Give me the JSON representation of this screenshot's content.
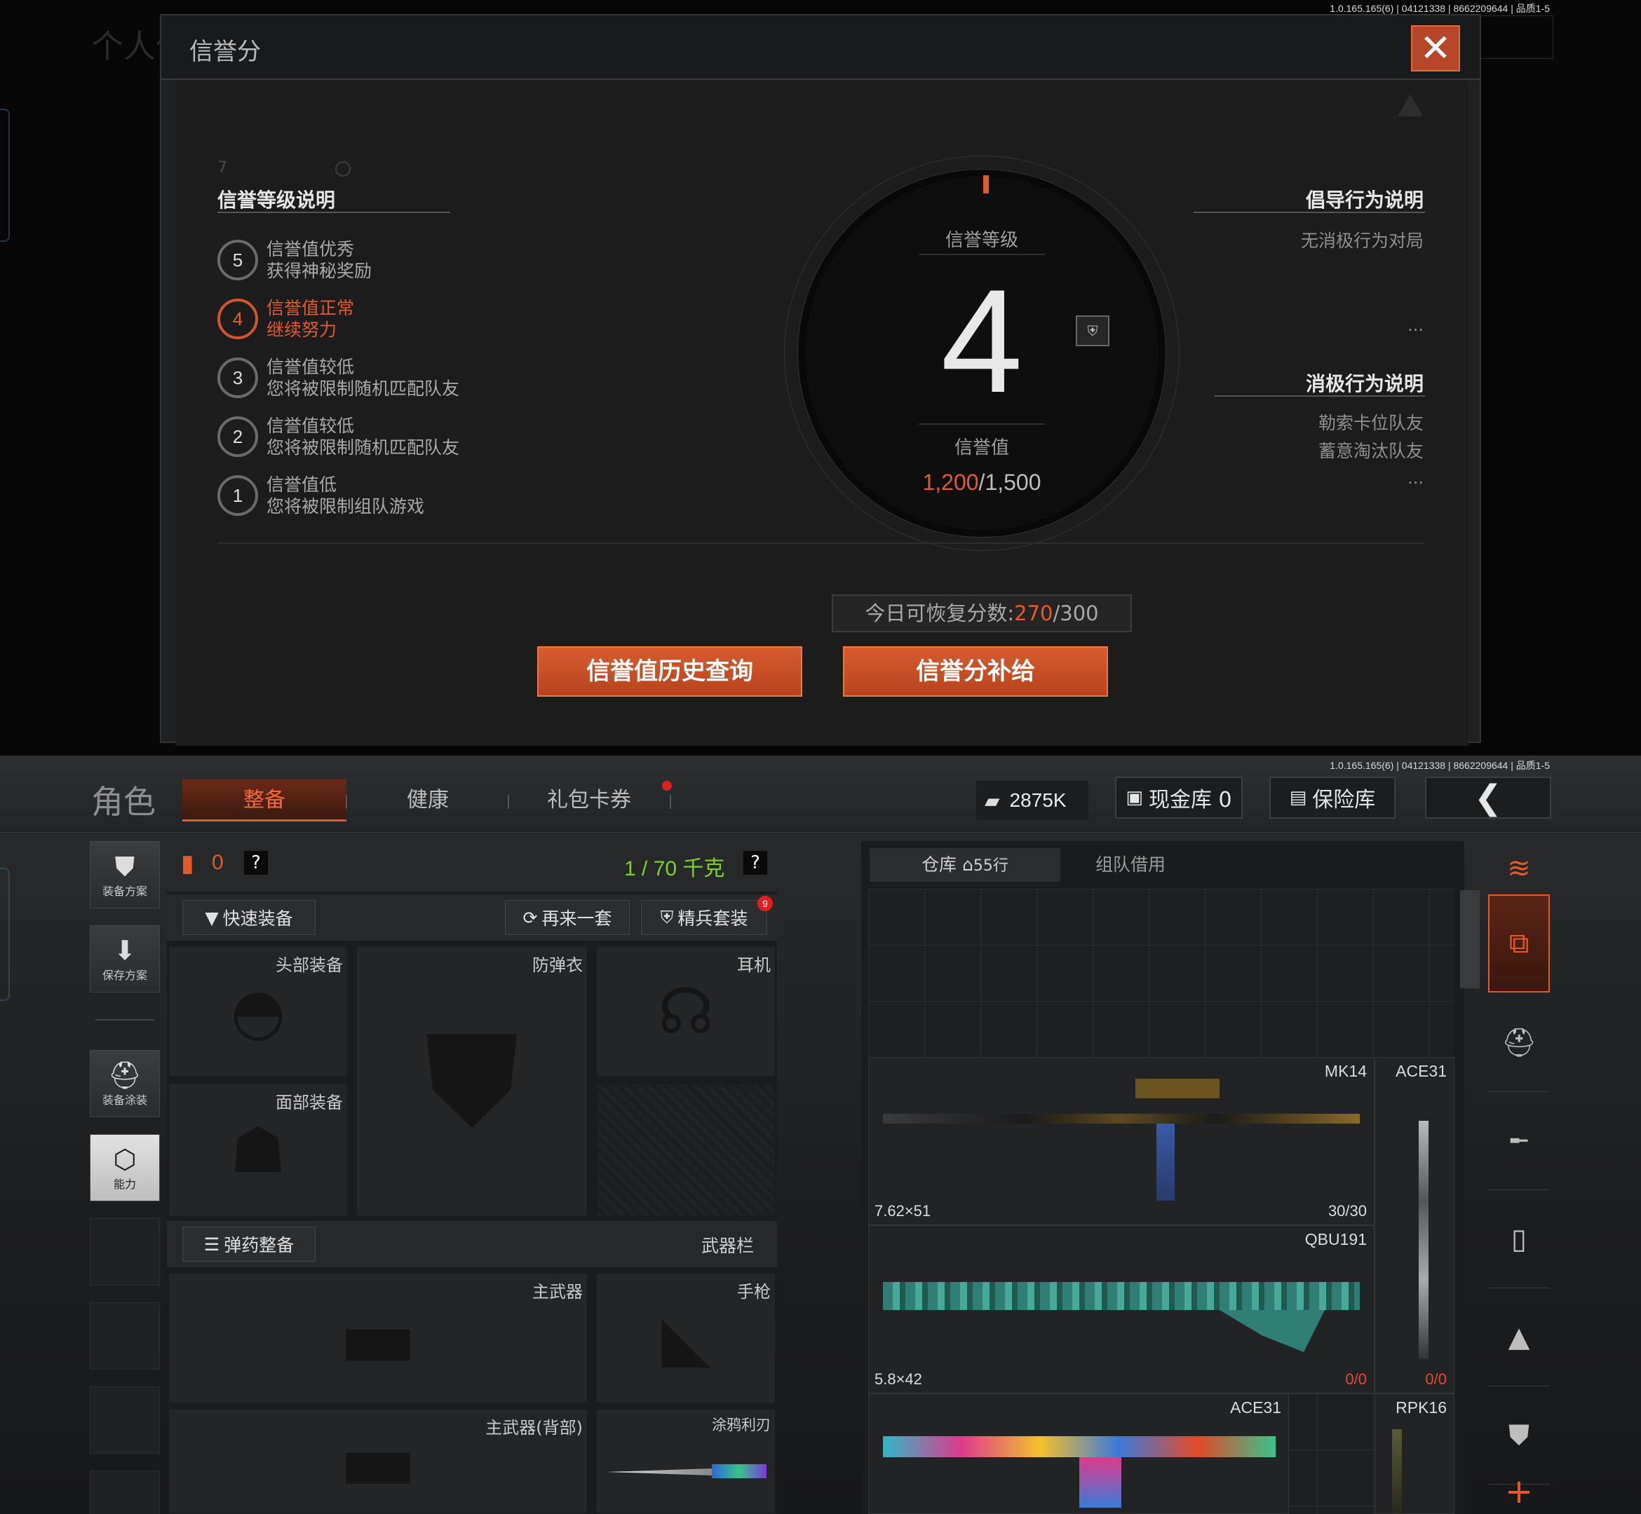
{
  "version_text": "1.0.165.165(6) | 04121338 | 8662209644 | 品质1-5",
  "credit_modal": {
    "bg_title": "个人信",
    "title": "信誉分",
    "close_icon": "close-icon",
    "levels_heading": "信誉等级说明",
    "levels": [
      {
        "level": "5",
        "line1": "信誉值优秀",
        "line2": "获得神秘奖励",
        "active": false
      },
      {
        "level": "4",
        "line1": "信誉值正常",
        "line2": "继续努力",
        "active": true
      },
      {
        "level": "3",
        "line1": "信誉值较低",
        "line2": "您将被限制随机匹配队友",
        "active": false
      },
      {
        "level": "2",
        "line1": "信誉值较低",
        "line2": "您将被限制随机匹配队友",
        "active": false
      },
      {
        "level": "1",
        "line1": "信誉值低",
        "line2": "您将被限制组队游戏",
        "active": false
      }
    ],
    "gauge": {
      "level_label": "信誉等级",
      "level": "4",
      "value_label": "信誉值",
      "current": "1,200",
      "max": "/1,500"
    },
    "encouraged_heading": "倡导行为说明",
    "encouraged_items": [
      "无消极行为对局"
    ],
    "negative_heading": "消极行为说明",
    "negative_items": [
      "勒索卡位队友",
      "蓄意淘汰队友"
    ],
    "more": "...",
    "restore_label": "今日可恢复分数:",
    "restore_current": "270",
    "restore_max": "/300",
    "history_button": "信誉值历史查询",
    "supply_button": "信誉分补给"
  },
  "loadout": {
    "role_title": "角色",
    "tabs": [
      {
        "label": "整备",
        "active": true
      },
      {
        "label": "健康",
        "active": false
      },
      {
        "label": "礼包卡券",
        "active": false
      }
    ],
    "money": "2875K",
    "cash_vault": "现金库 0",
    "safe_box": "保险库",
    "back_icon": "back-arrow-icon",
    "left_nav": [
      {
        "label": "装备方案",
        "icon": "vest-icon"
      },
      {
        "label": "保存方案",
        "icon": "download-icon"
      },
      {
        "label": "装备涂装",
        "icon": "helmet-paint-icon"
      },
      {
        "label": "能力",
        "icon": "ability-icon"
      }
    ],
    "armor_count": "0",
    "weight": "1 / 70 千克",
    "help": "?",
    "quick_equip": "快速装备",
    "again": "再来一套",
    "elite_set": "精兵套装",
    "elite_badge": "9",
    "slots": {
      "head": "头部装备",
      "vest": "防弹衣",
      "earphone": "耳机",
      "face": "面部装备",
      "ammo_button": "弹药整备",
      "weapon_bar": "武器栏",
      "primary": "主武器",
      "pistol": "手枪",
      "primary_back": "主武器(背部)",
      "melee": "涂鸦利刃"
    },
    "warehouse": {
      "tab_warehouse": "仓库",
      "rows": "55行",
      "tab_team": "组队借用",
      "weapons": [
        {
          "name": "MK14",
          "caliber": "7.62×51",
          "ammo": "30/30",
          "ammo_red": false
        },
        {
          "name": "ACE31",
          "caliber": "",
          "ammo": "",
          "ammo_red": false
        },
        {
          "name": "QBU191",
          "caliber": "5.8×42",
          "ammo": "0/0",
          "ammo_red": true
        },
        {
          "name": "",
          "caliber": "",
          "ammo": "0/0",
          "ammo_red": true
        },
        {
          "name": "ACE31",
          "caliber": "",
          "ammo": "",
          "ammo_red": false
        },
        {
          "name": "RPK16",
          "caliber": "",
          "ammo": "",
          "ammo_red": false
        }
      ]
    },
    "right_nav_icons": [
      "sort-icon",
      "stack-icon",
      "helmet-icon",
      "rifle-icon",
      "magazine-icon",
      "bullet-icon",
      "parts-icon",
      "add-icon"
    ]
  }
}
